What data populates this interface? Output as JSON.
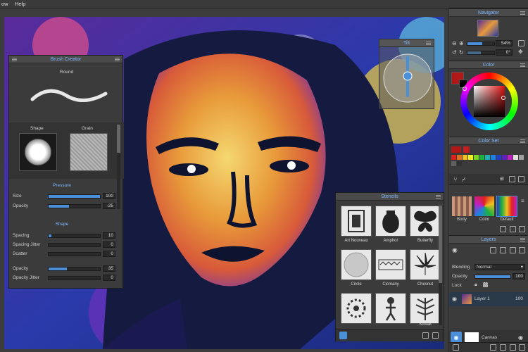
{
  "menu": {
    "window_partial": "ow",
    "help": "Help"
  },
  "brush_creator": {
    "title": "Brush Creator",
    "brush_name": "Round",
    "shape_label": "Shape",
    "grain_label": "Grain",
    "pressure_section": "Pressure",
    "pressure": [
      {
        "label": "Size",
        "value": "100",
        "fraction": 1.0
      },
      {
        "label": "Opacity",
        "value": "-25",
        "fraction": 0.4
      }
    ],
    "shape_section": "Shape",
    "shape": [
      {
        "label": "Spacing",
        "value": "10",
        "fraction": 0.06
      },
      {
        "label": "Spacing Jitter",
        "value": "0",
        "fraction": 0.0
      },
      {
        "label": "Scatter",
        "value": "0",
        "fraction": 0.0
      },
      {
        "label": "Opacity",
        "value": "35",
        "fraction": 0.35
      },
      {
        "label": "Opacity Jitter",
        "value": "0",
        "fraction": 0.0
      }
    ]
  },
  "tilt": {
    "title": "Tilt"
  },
  "stencils": {
    "title": "Stencils",
    "items": [
      "Art Nouveau",
      "Amphor",
      "Butterfly",
      "Circle",
      "Cicmany",
      "Chesnut",
      "",
      "",
      "Slovak"
    ]
  },
  "navigator": {
    "title": "Navigator",
    "zoom": "54%",
    "rotation": "0°"
  },
  "color": {
    "title": "Color",
    "current": "#b01818"
  },
  "color_set": {
    "title": "Color Set",
    "swatches": [
      "#e02020",
      "#e07020",
      "#f0c020",
      "#f0f020",
      "#80d020",
      "#20b040",
      "#20b0b0",
      "#2080e0",
      "#2040c0",
      "#6020c0",
      "#c020c0",
      "#e0e0e0",
      "#a0a0a0",
      "#606060",
      "#303030"
    ]
  },
  "presets": {
    "items": [
      "Body",
      "Color",
      "Default"
    ]
  },
  "layers": {
    "title": "Layers",
    "blending_label": "Blending",
    "blending_value": "Normal",
    "opacity_label": "Opacity",
    "opacity_value": "100",
    "opacity_fraction": 1.0,
    "lock_label": "Lock",
    "layer_name": "Layer 1",
    "layer_opacity": "100",
    "canvas_label": "Canvas"
  }
}
